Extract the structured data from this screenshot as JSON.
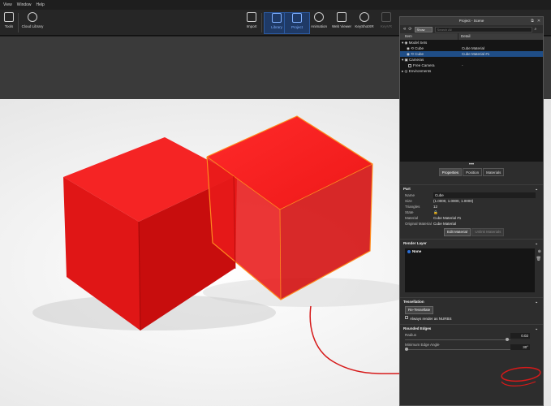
{
  "menubar": {
    "items": [
      "View",
      "Window",
      "Help"
    ]
  },
  "toolbar": {
    "left": [
      {
        "label": "Tools",
        "icon": "tools-icon"
      },
      {
        "label": "Cloud Library",
        "icon": "cloud-library-icon"
      }
    ],
    "right": [
      {
        "label": "Import",
        "icon": "import-icon"
      },
      {
        "label": "Library",
        "icon": "library-icon",
        "active": true
      },
      {
        "label": "Project",
        "icon": "project-icon",
        "active": true
      },
      {
        "label": "Animation",
        "icon": "animation-icon"
      },
      {
        "label": "Web Viewer",
        "icon": "web-viewer-icon"
      },
      {
        "label": "KeyShotXR",
        "icon": "keyshotxr-icon"
      },
      {
        "label": "KeyVR",
        "icon": "keyvr-icon",
        "disabled": true
      }
    ]
  },
  "panel": {
    "title": "Project - Scene",
    "show_select": "Show",
    "search_placeholder": "Search All",
    "columns": [
      "Item",
      "Detail"
    ],
    "tree": [
      {
        "label": "Model Sets",
        "detail": "",
        "indent": 0
      },
      {
        "label": "Cube",
        "detail": "Cube Material",
        "indent": 2
      },
      {
        "label": "Cube",
        "detail": "Cube Material #1",
        "indent": 2,
        "selected": true
      },
      {
        "label": "Cameras",
        "detail": "",
        "indent": 0
      },
      {
        "label": "Free Camera",
        "detail": "-",
        "indent": 2
      },
      {
        "label": "Environments",
        "detail": "",
        "indent": 0
      }
    ],
    "dots": "•••",
    "tabs": [
      "Properties",
      "Position",
      "Materials"
    ],
    "part": {
      "heading": "Part",
      "props": [
        {
          "k": "Name",
          "v": "Cube"
        },
        {
          "k": "Size",
          "v": "(1.0000, 1.0000, 1.0000)"
        },
        {
          "k": "Triangles",
          "v": "12"
        },
        {
          "k": "State",
          "v": "🔒"
        },
        {
          "k": "Material",
          "v": "Cube Material #1"
        },
        {
          "k": "Original Material",
          "v": "Cube Material"
        }
      ],
      "edit_material": "Edit Material",
      "unlink_materials": "Unlink Materials"
    },
    "render_layer": {
      "heading": "Render Layer",
      "item": "None"
    },
    "tessellation": {
      "heading": "Tessellation",
      "button": "Re-Tessellate",
      "checkbox": "Always render as NURBS"
    },
    "rounded_edges": {
      "heading": "Rounded Edges",
      "radius_label": "Radius",
      "radius_value": "0.02",
      "min_angle_label": "Minimum Edge Angle",
      "min_angle_value": "30°"
    }
  },
  "colors": {
    "cube": "#ee1c1c",
    "selection_outline": "#ff8a1e",
    "annotation": "#d61a1a",
    "accent": "#2c5aa0"
  }
}
